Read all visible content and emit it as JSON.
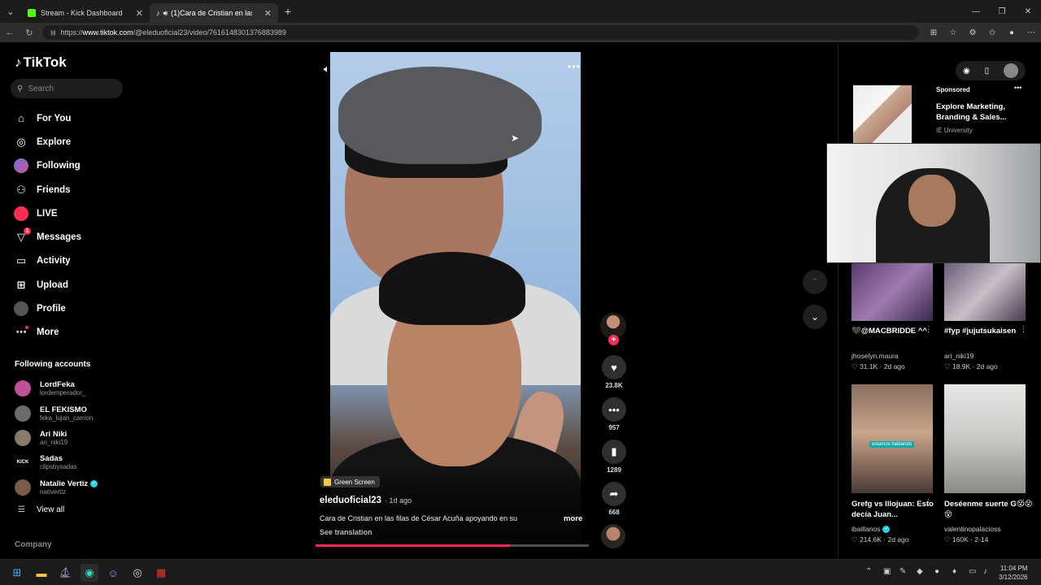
{
  "browser": {
    "tabs": [
      {
        "title": "Stream - Kick Dashboard",
        "favicon_color": "#53fc18"
      },
      {
        "title": "(1)Cara de Cristian en las filas",
        "favicon_color": "#ffffff"
      }
    ],
    "url_prefix": "https://",
    "url_host": "www.tiktok.com",
    "url_path": "/@eleduoficial23/video/7616148301376883989"
  },
  "sidebar": {
    "logo": "TikTok",
    "search_placeholder": "Search",
    "nav": [
      {
        "label": "For You",
        "icon": "home-icon"
      },
      {
        "label": "Explore",
        "icon": "compass-icon"
      },
      {
        "label": "Following",
        "icon": "following-avatar-icon"
      },
      {
        "label": "Friends",
        "icon": "friends-icon"
      },
      {
        "label": "LIVE",
        "icon": "live-icon"
      },
      {
        "label": "Messages",
        "icon": "messages-icon",
        "badge": "1"
      },
      {
        "label": "Activity",
        "icon": "activity-icon"
      },
      {
        "label": "Upload",
        "icon": "upload-icon"
      },
      {
        "label": "Profile",
        "icon": "profile-avatar-icon"
      },
      {
        "label": "More",
        "icon": "more-icon"
      }
    ],
    "following_title": "Following accounts",
    "following": [
      {
        "name": "LordFeka",
        "handle": "lordemperador_",
        "color": "#c0509a"
      },
      {
        "name": "EL FEKISMO",
        "handle": "feka_lujan_carrion",
        "color": "#6b6b6b"
      },
      {
        "name": "Ari Niki",
        "handle": "ari_niki19",
        "color": "#8a7a6a"
      },
      {
        "name": "Sadas",
        "handle": "clipsbysadas",
        "color": "#000000",
        "logo_text": "KICK"
      },
      {
        "name": "Natalie Vertiz",
        "handle": "nativertiz",
        "color": "#7a5a4a",
        "verified": true
      }
    ],
    "view_all": "View all",
    "company": "Company"
  },
  "video": {
    "tag": "Green Screen",
    "author": "eleduoficial23",
    "age": "· 1d ago",
    "caption": "Cara de Cristian en las filas de César Acuña apoyando en su",
    "more": "more",
    "see_translation": "See translation",
    "progress": 0.71
  },
  "actions": {
    "likes": "23.8K",
    "comments": "957",
    "saves": "1289",
    "shares": "668"
  },
  "right": {
    "sponsored_label": "Sponsored",
    "sponsored_title": "Explore Marketing, Branding & Sales...",
    "sponsored_source": "IE University",
    "thumbs": [
      {
        "caption": "🖤@MACBRIDDE ^^",
        "user": "jhoselyn.maura",
        "stats": "♡ 31.1K · 2d ago",
        "bg": "linear-gradient(135deg,#5a3a6e,#a07ab0 50%,#3a2a4a)"
      },
      {
        "caption": "#fyp #jujutsukaisen",
        "user": "ari_niki19",
        "stats": "♡ 18.9K · 2d ago",
        "bg": "linear-gradient(135deg,#6a5a7a,#c9c0c8 50%,#4a3a52)"
      },
      {
        "caption": "Grefg vs Illojuan: Esto decía Juan...",
        "user": "ibaillanos",
        "verified": true,
        "stats": "♡ 214.6K · 2d ago",
        "bg": "linear-gradient(180deg,#8a7060 0%,#c9a48a 45%,#4a3a34 100%)",
        "overlay": "estamos hablando"
      },
      {
        "caption": "Deséenme suerte G😵😵😵",
        "user": "valentinopalacioss",
        "stats": "♡ 160K · 2-14",
        "bg": "linear-gradient(180deg,#e6e6e4 0%,#c9c9c6 50%,#8a8a86 100%)"
      }
    ]
  },
  "taskbar": {
    "time": "11:04 PM",
    "date": "3/12/2026"
  }
}
